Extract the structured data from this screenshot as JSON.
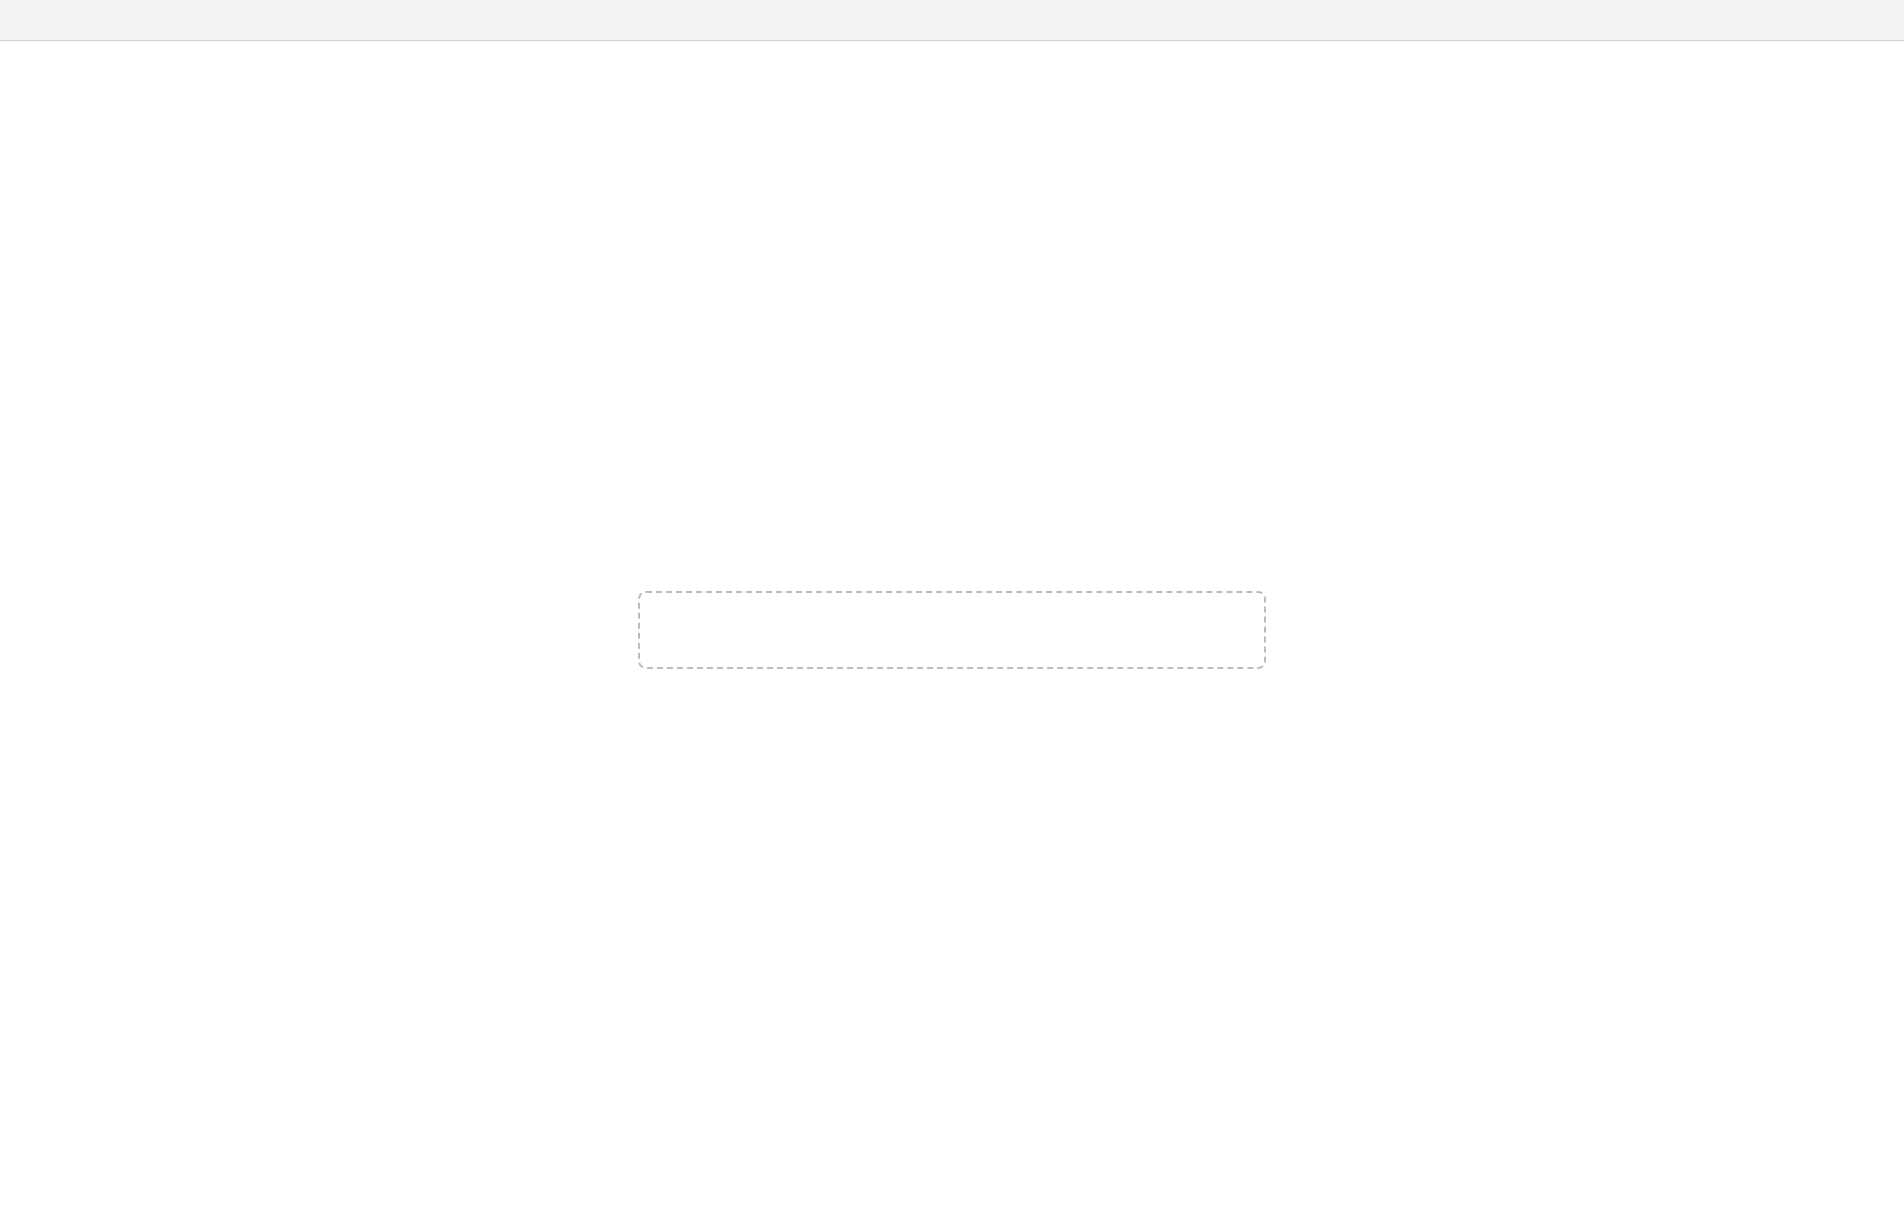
{
  "window": {
    "title": ""
  },
  "placeholder": {
    "heading": "",
    "body": ""
  }
}
